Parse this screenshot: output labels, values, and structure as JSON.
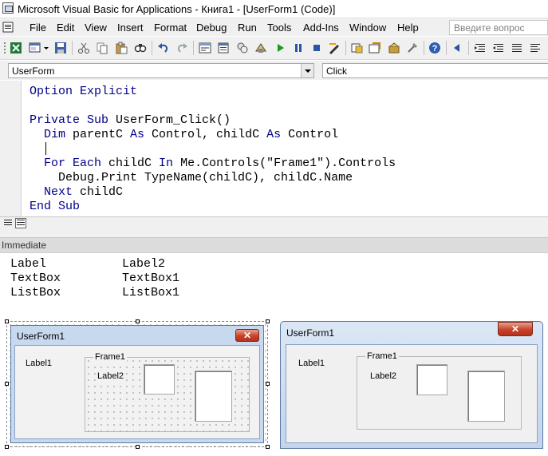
{
  "window": {
    "title": "Microsoft Visual Basic for Applications - Книга1 - [UserForm1 (Code)]"
  },
  "menu": {
    "items": [
      "File",
      "Edit",
      "View",
      "Insert",
      "Format",
      "Debug",
      "Run",
      "Tools",
      "Add-Ins",
      "Window",
      "Help"
    ],
    "help_placeholder": "Введите вопрос"
  },
  "toolbar": {
    "icons": [
      "view-excel-icon",
      "insert-userform-icon",
      "save-icon",
      "cut-icon",
      "copy-icon",
      "paste-icon",
      "find-icon",
      "undo-icon",
      "redo-icon",
      "run-sub-icon",
      "break-icon",
      "reset-icon",
      "design-mode-icon",
      "project-explorer-icon",
      "properties-icon",
      "object-browser-icon",
      "toolbox-icon",
      "help-icon",
      "back-icon",
      "indent-icon",
      "outdent-icon",
      "list-icon"
    ]
  },
  "combos": {
    "object": "UserForm",
    "procedure": "Click"
  },
  "code": {
    "lines": [
      [
        {
          "t": "Option Explicit",
          "k": true
        }
      ],
      [],
      [
        {
          "t": "Private Sub ",
          "k": true
        },
        {
          "t": "UserForm_Click()",
          "k": false
        }
      ],
      [
        {
          "t": "  Dim ",
          "k": true
        },
        {
          "t": "parentC ",
          "k": false
        },
        {
          "t": "As ",
          "k": true
        },
        {
          "t": "Control, childC ",
          "k": false
        },
        {
          "t": "As ",
          "k": true
        },
        {
          "t": "Control",
          "k": false
        }
      ],
      [],
      [
        {
          "t": "  For Each ",
          "k": true
        },
        {
          "t": "childC ",
          "k": false
        },
        {
          "t": "In ",
          "k": true
        },
        {
          "t": "Me.Controls(\"Frame1\").Controls",
          "k": false
        }
      ],
      [
        {
          "t": "    Debug.Print ",
          "k": false
        },
        {
          "t": "TypeName(childC), childC.Name",
          "k": false
        }
      ],
      [
        {
          "t": "  Next ",
          "k": true
        },
        {
          "t": "childC",
          "k": false
        }
      ],
      [
        {
          "t": "End Sub",
          "k": true
        }
      ]
    ]
  },
  "immediate": {
    "title": "Immediate",
    "rows": [
      {
        "type": "Label",
        "name": "Label2"
      },
      {
        "type": "TextBox",
        "name": "TextBox1"
      },
      {
        "type": "ListBox",
        "name": "ListBox1"
      }
    ]
  },
  "designer_form": {
    "title": "UserForm1",
    "frame_caption": "Frame1",
    "label1": "Label1",
    "label2": "Label2",
    "close_glyph": "✕"
  },
  "runtime_form": {
    "title": "UserForm1",
    "frame_caption": "Frame1",
    "label1": "Label1",
    "label2": "Label2",
    "close_glyph": "✕"
  },
  "colors": {
    "keyword": "#00008b",
    "window_border": "#c7d9ee",
    "close_button": "#c7412b"
  }
}
